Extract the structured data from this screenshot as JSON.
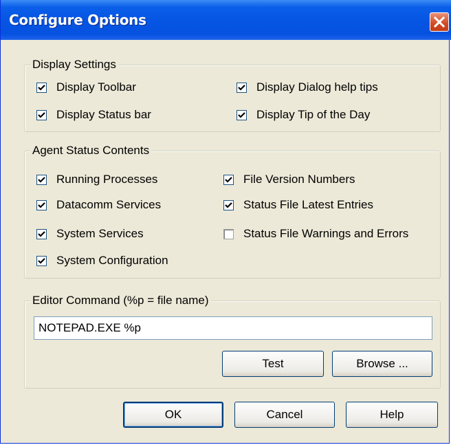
{
  "window": {
    "title": "Configure Options"
  },
  "display_settings": {
    "legend": "Display Settings",
    "options": [
      {
        "label": "Display Toolbar",
        "checked": true
      },
      {
        "label": "Display Status bar",
        "checked": true
      },
      {
        "label": "Display Dialog help tips",
        "checked": true
      },
      {
        "label": "Display Tip of the Day",
        "checked": true
      }
    ]
  },
  "agent_status": {
    "legend": "Agent Status Contents",
    "options": [
      {
        "label": "Running Processes",
        "checked": true
      },
      {
        "label": "Datacomm Services",
        "checked": true
      },
      {
        "label": "System Services",
        "checked": true
      },
      {
        "label": "System Configuration",
        "checked": true
      },
      {
        "label": "File Version Numbers",
        "checked": true
      },
      {
        "label": "Status File Latest Entries",
        "checked": true
      },
      {
        "label": "Status File Warnings and Errors",
        "checked": false
      }
    ]
  },
  "editor": {
    "legend": "Editor Command (%p = file name)",
    "value": "NOTEPAD.EXE %p",
    "test_label": "Test",
    "browse_label": "Browse ..."
  },
  "footer": {
    "ok_label": "OK",
    "cancel_label": "Cancel",
    "help_label": "Help"
  },
  "colors": {
    "titlebar": "#0554e3",
    "dialog_bg": "#ece9d8",
    "close_button": "#cf4a23",
    "checkmark": "#21a121"
  }
}
